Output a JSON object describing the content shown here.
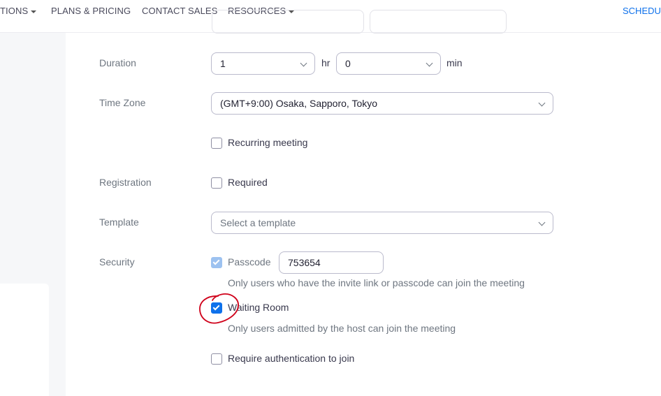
{
  "nav": {
    "solutions": "TIONS",
    "plans": "PLANS & PRICING",
    "contact": "CONTACT SALES",
    "resources": "RESOURCES",
    "schedule": "SCHEDUL"
  },
  "form": {
    "duration": {
      "label": "Duration",
      "hours": "1",
      "hr_unit": "hr",
      "minutes": "0",
      "min_unit": "min"
    },
    "timezone": {
      "label": "Time Zone",
      "value": "(GMT+9:00) Osaka, Sapporo, Tokyo"
    },
    "recurring": {
      "label": "Recurring meeting",
      "checked": false
    },
    "registration": {
      "label": "Registration",
      "option": "Required",
      "checked": false
    },
    "template": {
      "label": "Template",
      "placeholder": "Select a template"
    },
    "security": {
      "label": "Security",
      "passcode": {
        "label": "Passcode",
        "value": "753654",
        "checked": true,
        "help": "Only users who have the invite link or passcode can join the meeting"
      },
      "waiting_room": {
        "label": "Waiting Room",
        "checked": true,
        "help": "Only users admitted by the host can join the meeting"
      },
      "auth": {
        "label": "Require authentication to join",
        "checked": false
      }
    }
  },
  "colors": {
    "accent": "#0e71eb",
    "annotation": "#d0021b"
  }
}
